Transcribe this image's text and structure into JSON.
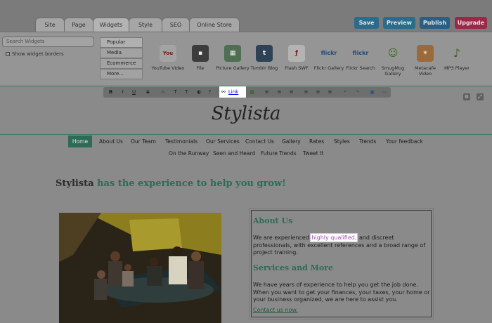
{
  "tabs": [
    {
      "label": "Site",
      "active": false
    },
    {
      "label": "Page",
      "active": false
    },
    {
      "label": "Widgets",
      "active": true
    },
    {
      "label": "Style",
      "active": false
    },
    {
      "label": "SEO",
      "active": false
    },
    {
      "label": "Online Store",
      "active": false
    }
  ],
  "actions": {
    "save": "Save",
    "preview": "Preview",
    "publish": "Publish",
    "upgrade": "Upgrade"
  },
  "colors": {
    "save": "#2a6c8c",
    "preview": "#2a6c8c",
    "publish": "#2a5f85",
    "upgrade": "#9c2747",
    "accent": "#2d6b55"
  },
  "panel": {
    "search_placeholder": "Search Widgets",
    "show_borders": "Show widget borders",
    "categories": [
      "Popular",
      "Media",
      "Ecommerce",
      "More..."
    ],
    "widgets": [
      {
        "label": "YouTube Video",
        "icon": "youtube-icon"
      },
      {
        "label": "File",
        "icon": "floppy-disk-icon"
      },
      {
        "label": "Picture Gallery",
        "icon": "picture-gallery-icon"
      },
      {
        "label": "Tumblr Blog",
        "icon": "tumblr-icon"
      },
      {
        "label": "Flash SWF",
        "icon": "flash-icon"
      },
      {
        "label": "Flickr Gallery",
        "icon": "flickr-icon"
      },
      {
        "label": "Flickr Search",
        "icon": "flickr-search-icon"
      },
      {
        "label": "SmugMug Gallery",
        "icon": "smugmug-icon"
      },
      {
        "label": "Metacafe Video",
        "icon": "metacafe-icon"
      },
      {
        "label": "MP3 Player",
        "icon": "music-note-icon"
      }
    ]
  },
  "toolbar": {
    "link_label": "Link"
  },
  "site": {
    "title": "Stylista",
    "nav_row1": [
      "Home",
      "About Us",
      "Our Team",
      "Testimonials",
      "Our Services",
      "Contact Us",
      "Gallery",
      "Rates",
      "Styles",
      "Trends",
      "Your feedback"
    ],
    "nav_row2": [
      "On the Runway",
      "Seen and Heard",
      "Future Trends",
      "Tweet It"
    ],
    "headline_brand": "Stylista",
    "headline_rest": "has the experience to help you grow!",
    "about_heading": "About Us",
    "about_pre": "We are experienced",
    "about_highlight": "highly qualified,",
    "about_post": "and discreet professionals, with excellent references and a broad range of project training.",
    "services_heading": "Services and More",
    "services_text": "We have years of experience to help you get the job done. When you want to get your finances, your taxes, your home or your business organized, we are here to assist you.",
    "contact_link": "Contact us now."
  }
}
